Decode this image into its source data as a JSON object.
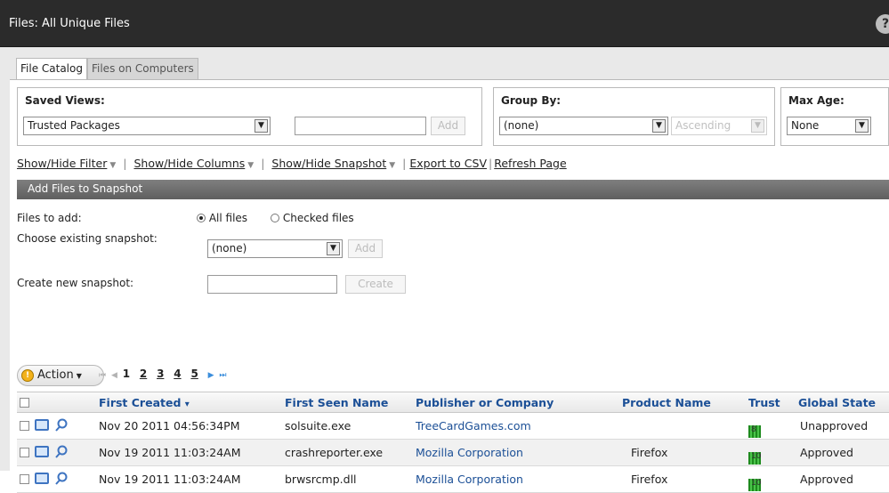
{
  "window": {
    "title": "Files: All Unique Files",
    "help_icon": "?"
  },
  "tabs": [
    {
      "label": "File Catalog"
    },
    {
      "label": "Files on Computers"
    }
  ],
  "saved_views": {
    "label": "Saved Views:",
    "selected": "Trusted Packages",
    "name_value": "",
    "add_label": "Add"
  },
  "group_by": {
    "label": "Group By:",
    "selected": "(none)",
    "order": "Ascending"
  },
  "max_age": {
    "label": "Max Age:",
    "selected": "None"
  },
  "links": {
    "show_filter": "Show/Hide Filter",
    "show_columns": "Show/Hide Columns",
    "show_snapshot": "Show/Hide Snapshot",
    "export_csv": "Export to CSV",
    "refresh": "Refresh Page"
  },
  "snapshot": {
    "title": "Add Files to Snapshot",
    "files_to_add_label": "Files to add:",
    "all_files": "All files",
    "checked_files": "Checked files",
    "choose_existing_label": "Choose existing snapshot:",
    "existing_selected": "(none)",
    "add_label": "Add",
    "create_new_label": "Create new snapshot:",
    "create_label": "Create"
  },
  "toolbar": {
    "action_label": "Action",
    "pages": [
      "1",
      "2",
      "3",
      "4",
      "5"
    ],
    "current_page": "1"
  },
  "columns": [
    "First Created",
    "First Seen Name",
    "Publisher or Company",
    "Product Name",
    "Trust",
    "Global State"
  ],
  "sort_indicator": "▾",
  "rows": [
    {
      "created": "Nov 20 2011 04:56:34PM",
      "name": "solsuite.exe",
      "publisher": "TreeCardGames.com",
      "product": "",
      "trust": "8",
      "state": "Unapproved"
    },
    {
      "created": "Nov 19 2011 11:03:24AM",
      "name": "crashreporter.exe",
      "publisher": "Mozilla Corporation",
      "product": "Firefox",
      "trust": "10",
      "state": "Approved"
    },
    {
      "created": "Nov 19 2011 11:03:24AM",
      "name": "brwsrcmp.dll",
      "publisher": "Mozilla Corporation",
      "product": "Firefox",
      "trust": "10",
      "state": "Approved"
    }
  ],
  "colors": {
    "title_bar": "#2b2b2b",
    "link_blue": "#1b4f96",
    "trust_green": "#2e9e2e"
  }
}
